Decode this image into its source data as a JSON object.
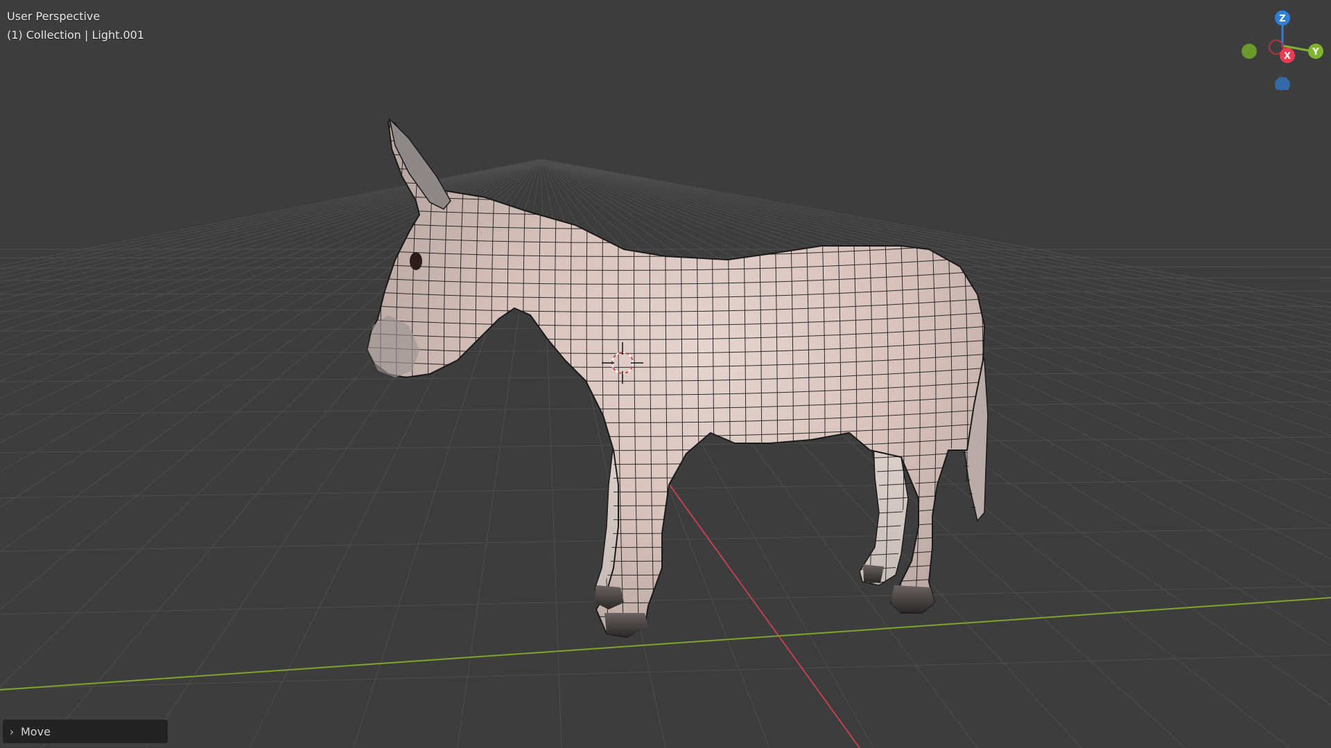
{
  "viewport": {
    "view_name": "User Perspective",
    "active_object": "(1) Collection | Light.001",
    "grid_color": "#4e4e4e",
    "background_color": "#3d3d3d",
    "x_axis_color": "#c0404f",
    "y_axis_color": "#7ea42d",
    "mesh_color": "#d9c9c3",
    "wire_color": "#1a1a1a"
  },
  "gizmo": {
    "z_label": "Z",
    "x_label": "X",
    "y_label": "Y",
    "z_color": "#2f7fd8",
    "x_color": "#ef3a55",
    "y_color": "#82b32f",
    "neg_y_color": "#6a9a2b",
    "neg_z_color": "#3569a6"
  },
  "operator_panel": {
    "icon": "chevron-right-icon",
    "label": "Move"
  }
}
